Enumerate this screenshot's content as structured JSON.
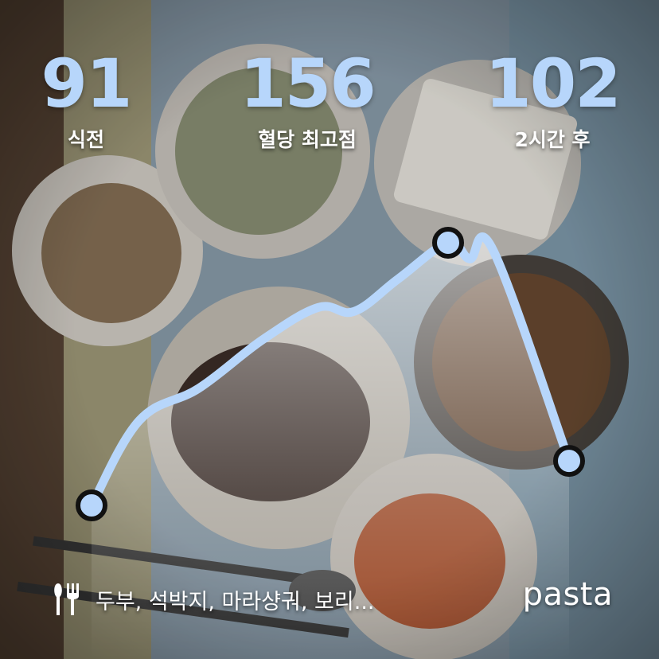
{
  "stats": {
    "before": {
      "value": "91",
      "label": "식전"
    },
    "peak": {
      "value": "156",
      "label": "혈당 최고점"
    },
    "after": {
      "value": "102",
      "label": "2시간 후"
    }
  },
  "meal": {
    "icon": "utensils-icon",
    "text": "두부, 석박지, 마라샹궈, 보리..."
  },
  "brand": "pasta",
  "chart_data": {
    "type": "line",
    "title": "",
    "xlabel": "",
    "ylabel": "",
    "series": [
      {
        "values": [
          91,
          112,
          120,
          132,
          140,
          139,
          147,
          156,
          152,
          154,
          102
        ]
      }
    ],
    "markers": [
      0,
      7,
      10
    ],
    "ylim": [
      85,
      160
    ]
  },
  "colors": {
    "accent": "#b7d6fb",
    "line": "#b7d6fb",
    "marker_stroke": "#111111"
  }
}
